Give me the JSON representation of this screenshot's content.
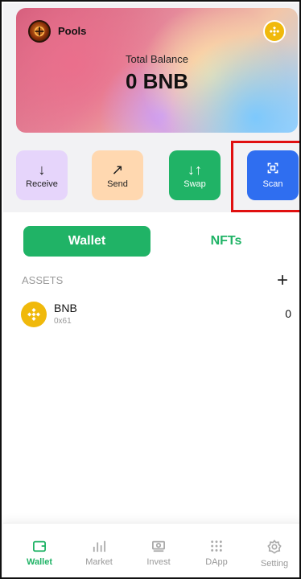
{
  "header": {
    "account_name": "Pools",
    "balance_title": "Total Balance",
    "balance_value": "0 BNB"
  },
  "actions": {
    "receive": "Receive",
    "send": "Send",
    "swap": "Swap",
    "scan": "Scan"
  },
  "tabs": {
    "wallet": "Wallet",
    "nfts": "NFTs"
  },
  "assets": {
    "section_label": "ASSETS",
    "add_symbol": "+",
    "items": [
      {
        "name": "BNB",
        "address": "0x61",
        "amount": "0"
      }
    ]
  },
  "bottom_nav": {
    "items": [
      {
        "label": "Wallet",
        "icon": "wallet-icon",
        "active": true
      },
      {
        "label": "Market",
        "icon": "bar-chart-icon",
        "active": false
      },
      {
        "label": "Invest",
        "icon": "cash-icon",
        "active": false
      },
      {
        "label": "DApp",
        "icon": "grid-dots-icon",
        "active": false
      },
      {
        "label": "Setting",
        "icon": "gear-icon",
        "active": false
      }
    ]
  },
  "colors": {
    "primary_green": "#20b366",
    "scan_blue": "#2f6ef0",
    "bnb_yellow": "#f0b90b",
    "highlight_red": "#e01010"
  }
}
